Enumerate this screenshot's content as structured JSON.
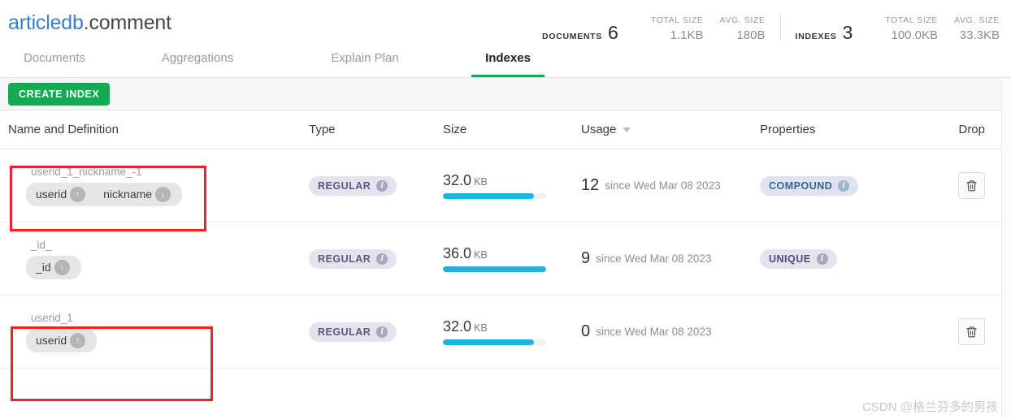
{
  "header": {
    "database": "articledb",
    "separator": ".",
    "collection": "comment",
    "stats": {
      "documents": {
        "label": "Documents",
        "value": "6"
      },
      "documents_total_size": {
        "label": "Total size",
        "value": "1.1KB"
      },
      "documents_avg_size": {
        "label": "Avg. size",
        "value": "180B"
      },
      "indexes": {
        "label": "Indexes",
        "value": "3"
      },
      "indexes_total_size": {
        "label": "Total size",
        "value": "100.0KB"
      },
      "indexes_avg_size": {
        "label": "Avg. size",
        "value": "33.3KB"
      }
    }
  },
  "tabs": [
    {
      "label": "Documents",
      "active": false
    },
    {
      "label": "Aggregations",
      "active": false
    },
    {
      "label": "Explain Plan",
      "active": false
    },
    {
      "label": "Indexes",
      "active": true
    }
  ],
  "toolbar": {
    "create_index_label": "Create Index"
  },
  "table": {
    "columns": [
      {
        "label": "Name and Definition",
        "sortable": false
      },
      {
        "label": "Type",
        "sortable": false
      },
      {
        "label": "Size",
        "sortable": false
      },
      {
        "label": "Usage",
        "sortable": true,
        "sort_direction": "desc"
      },
      {
        "label": "Properties",
        "sortable": false
      },
      {
        "label": "Drop",
        "sortable": false
      }
    ],
    "rows": [
      {
        "name": "userid_1_nickname_-1",
        "keys": [
          {
            "field": "userid",
            "direction": "asc",
            "icon": "arrow-up-icon"
          },
          {
            "field": "nickname",
            "direction": "desc",
            "icon": "arrow-down-icon"
          }
        ],
        "type": "Regular",
        "size_value": "32.0",
        "size_unit": "KB",
        "size_bar_percent": 88,
        "usage_count": "12",
        "usage_since": "since Wed Mar 08 2023",
        "properties": "Compound",
        "has_drop": true,
        "highlighted": true
      },
      {
        "name": "_id_",
        "keys": [
          {
            "field": "_id",
            "direction": "asc",
            "icon": "arrow-up-icon"
          }
        ],
        "type": "Regular",
        "size_value": "36.0",
        "size_unit": "KB",
        "size_bar_percent": 100,
        "usage_count": "9",
        "usage_since": "since Wed Mar 08 2023",
        "properties": "Unique",
        "has_drop": false,
        "highlighted": false
      },
      {
        "name": "userid_1",
        "keys": [
          {
            "field": "userid",
            "direction": "asc",
            "icon": "arrow-up-icon"
          }
        ],
        "type": "Regular",
        "size_value": "32.0",
        "size_unit": "KB",
        "size_bar_percent": 88,
        "usage_count": "0",
        "usage_since": "since Wed Mar 08 2023",
        "properties": "",
        "has_drop": true,
        "highlighted": true
      }
    ]
  },
  "watermark": "CSDN @格兰芬多的男孩",
  "colors": {
    "brand_green": "#13aa52",
    "db_blue": "#3b80c4",
    "usage_bar": "#20b2e0",
    "annotation_red": "#f32020"
  }
}
